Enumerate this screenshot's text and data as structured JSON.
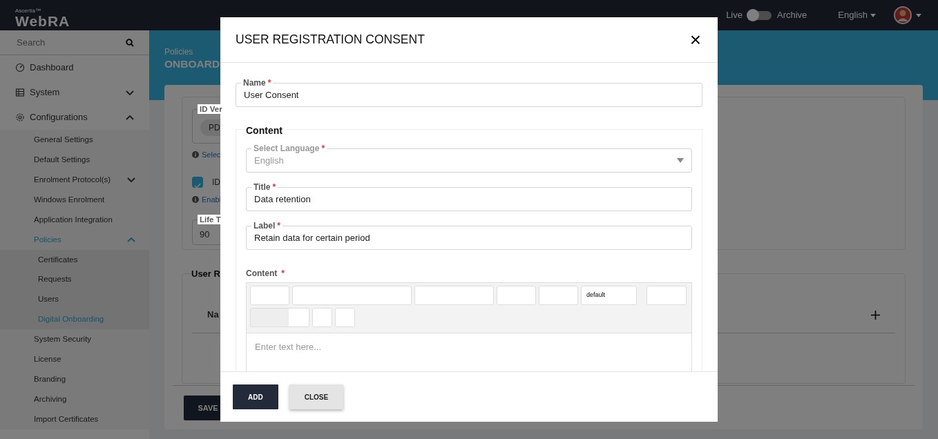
{
  "topbar": {
    "brand_small": "Ascertia™",
    "brand": "WebRA",
    "live_label": "Live",
    "archive_on": false,
    "archive_label": "Archive",
    "language": "English"
  },
  "sidebar": {
    "search_placeholder": "Search",
    "items": [
      {
        "label": "Dashboard",
        "selected": false
      },
      {
        "label": "System",
        "selected": false,
        "expanded": false
      },
      {
        "label": "Configurations",
        "selected": false,
        "expanded": true,
        "children": [
          {
            "label": "General Settings",
            "selected": false
          },
          {
            "label": "Default Settings",
            "selected": false
          },
          {
            "label": "Enrolment Protocol(s)",
            "selected": false,
            "expanded": false
          },
          {
            "label": "Windows Enrolment",
            "selected": false
          },
          {
            "label": "Application Integration",
            "selected": false
          },
          {
            "label": "Policies",
            "selected": true,
            "expanded": true,
            "children": [
              {
                "label": "Certificates",
                "selected": false
              },
              {
                "label": "Requests",
                "selected": false
              },
              {
                "label": "Users",
                "selected": false
              },
              {
                "label": "Digital Onboarding",
                "selected": true
              }
            ]
          },
          {
            "label": "System Security",
            "selected": false
          },
          {
            "label": "License",
            "selected": false
          },
          {
            "label": "Branding",
            "selected": false
          },
          {
            "label": "Archiving",
            "selected": false
          },
          {
            "label": "Import Certificates",
            "selected": false
          }
        ]
      }
    ]
  },
  "page": {
    "breadcrumb": "Policies",
    "title": "ONBOARD",
    "id_field_label": "ID Ver",
    "chip": "PD",
    "hint_1": "Selec",
    "checkbox": {
      "label": "ID",
      "checked": true
    },
    "hint_2": "Enabl",
    "lifetime": {
      "label": "Life T",
      "value": "90"
    },
    "section_title": "User R",
    "column_1": "Na",
    "save": "SAVE"
  },
  "modal": {
    "title": "USER REGISTRATION CONSENT",
    "close": "×",
    "name": {
      "label": "Name",
      "marker": "*",
      "value": "User Consent"
    },
    "content": {
      "legend": "Content",
      "fields": [
        {
          "kind": "select",
          "label": "Select Language",
          "marker": "*",
          "value": "English",
          "disabled": true
        },
        {
          "kind": "text",
          "label": "Title",
          "marker": "*",
          "value": "Data retention",
          "disabled": false
        },
        {
          "kind": "text",
          "label": "Label",
          "marker": "*",
          "value": "Retain data for certain period",
          "disabled": false
        }
      ],
      "editor": {
        "label": "Content",
        "marker": "*",
        "toolbar": [
          [
            {
              "kind": "small"
            },
            {
              "kind": "wide"
            },
            {
              "kind": "medium"
            },
            {
              "kind": "small"
            },
            {
              "kind": "small"
            },
            {
              "kind": "dropdown",
              "value": "default"
            },
            {
              "kind": "spaced"
            }
          ],
          [
            {
              "kind": "color"
            },
            {
              "kind": "icon"
            },
            {
              "kind": "icon"
            }
          ]
        ],
        "placeholder": "Enter text here..."
      }
    },
    "buttons": [
      {
        "label": "ADD",
        "primary": true
      },
      {
        "label": "CLOSE",
        "primary": false
      }
    ]
  }
}
